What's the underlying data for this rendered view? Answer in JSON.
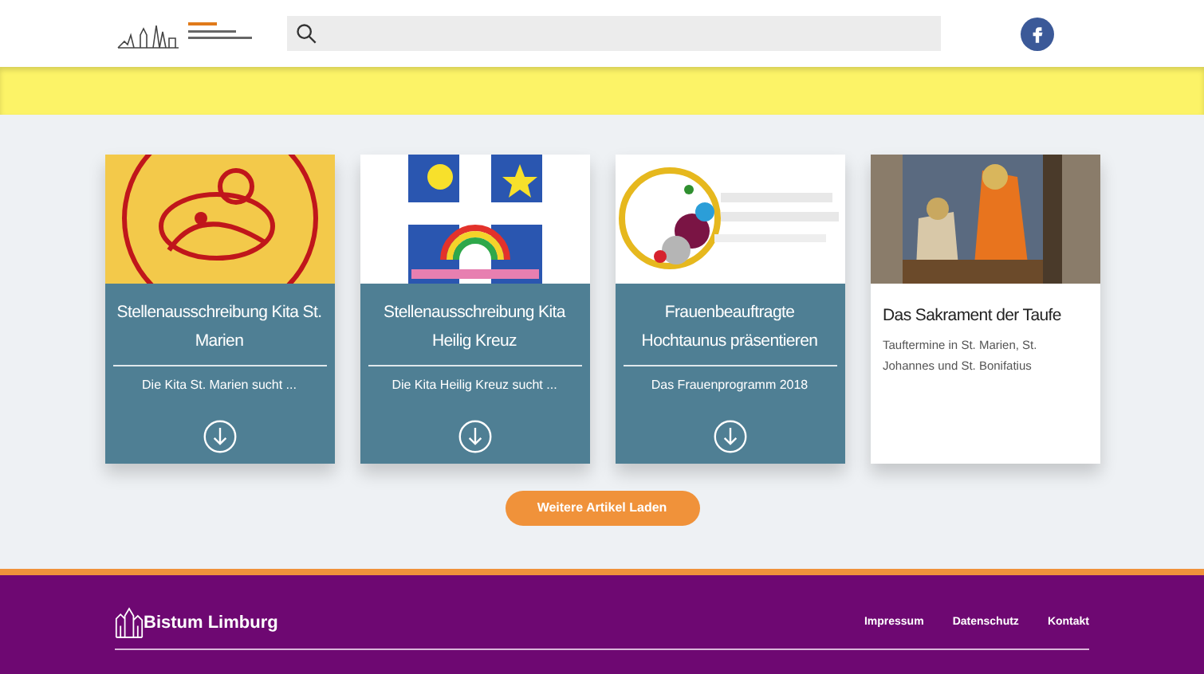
{
  "cards": [
    {
      "kind": "teaser",
      "title": "Stellenausschreibung Kita St. Marien",
      "text": "Die Kita St. Marien sucht ..."
    },
    {
      "kind": "teaser",
      "title": "Stellenausschreibung Kita Heilig Kreuz",
      "text": "Die Kita Heilig Kreuz sucht ..."
    },
    {
      "kind": "teaser",
      "title": "Frauenbeauftragte Hochtaunus präsentieren",
      "text": "Das Frauenprogramm 2018"
    },
    {
      "kind": "article",
      "title": "Das Sakrament der Taufe",
      "text": "Tauftermine in St. Marien, St. Johannes und St. Bonifatius"
    }
  ],
  "load_more": "Weitere Artikel Laden",
  "footer": {
    "brand": "Bistum Limburg",
    "links": [
      "Impressum",
      "Datenschutz",
      "Kontakt"
    ]
  }
}
